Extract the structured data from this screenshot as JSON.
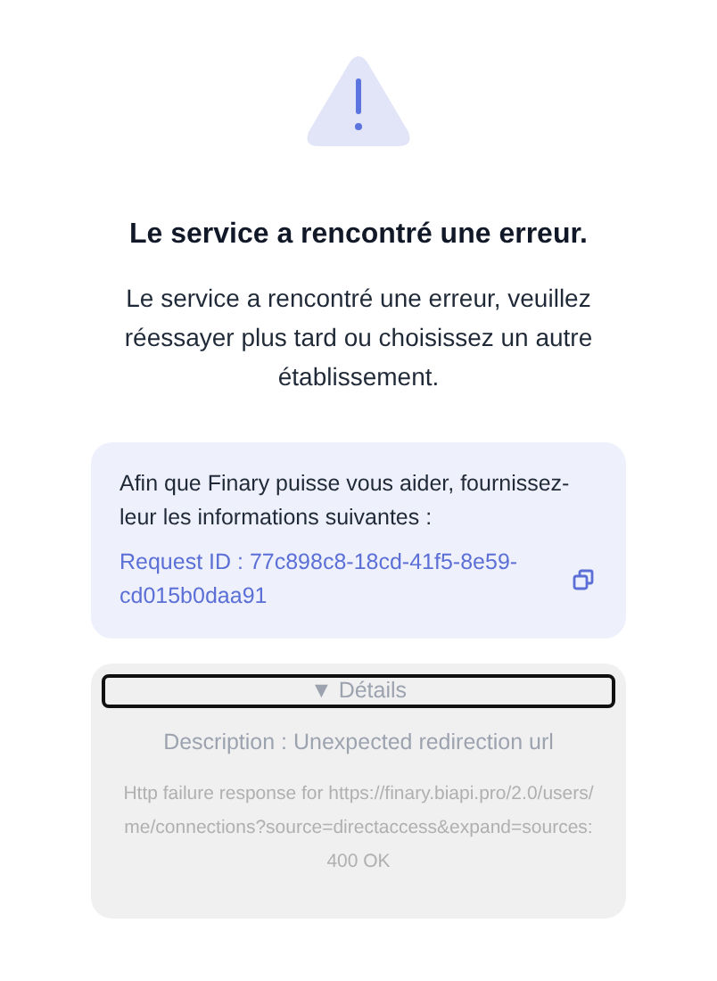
{
  "title": "Le service a rencontré une erreur.",
  "message": "Le service a rencontré une erreur, veuillez réessayer plus tard ou choisissez un autre établissement.",
  "help_box": {
    "text": "Afin que Finary puisse vous aider, fournissez-leur les informations suivantes :",
    "request_id": "Request ID : 77c898c8-18cd-41f5-8e59-cd015b0daa91"
  },
  "details": {
    "toggle": "▼ Détails",
    "expanded": true,
    "description": "Description : Unexpected redirection url",
    "error": "Http failure response for https://finary.biapi.pro/2.0/users/me/connections?source=directaccess&expand=sources: 400 OK"
  }
}
